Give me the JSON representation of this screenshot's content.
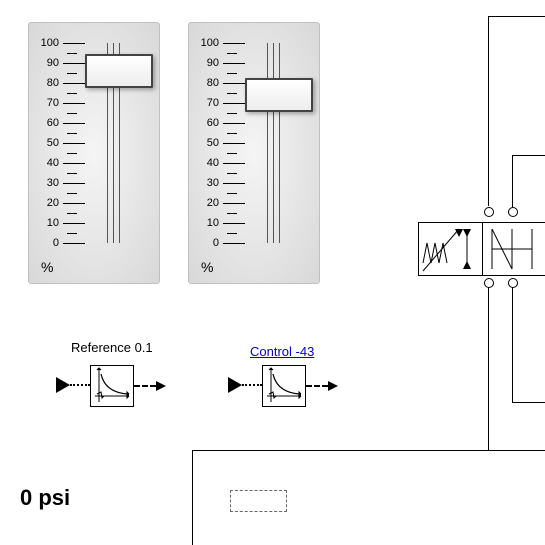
{
  "sliders": [
    {
      "id": "slider1",
      "unit": "%",
      "value": 87,
      "ticks": [
        100,
        90,
        80,
        70,
        60,
        50,
        40,
        30,
        20,
        10,
        0
      ]
    },
    {
      "id": "slider2",
      "unit": "%",
      "value": 75,
      "ticks": [
        100,
        90,
        80,
        70,
        60,
        50,
        40,
        30,
        20,
        10,
        0
      ]
    }
  ],
  "blocks": {
    "reference": {
      "label": "Reference 0.1"
    },
    "control": {
      "label": "Control -43"
    }
  },
  "readout": {
    "pressure": "0 psi"
  }
}
